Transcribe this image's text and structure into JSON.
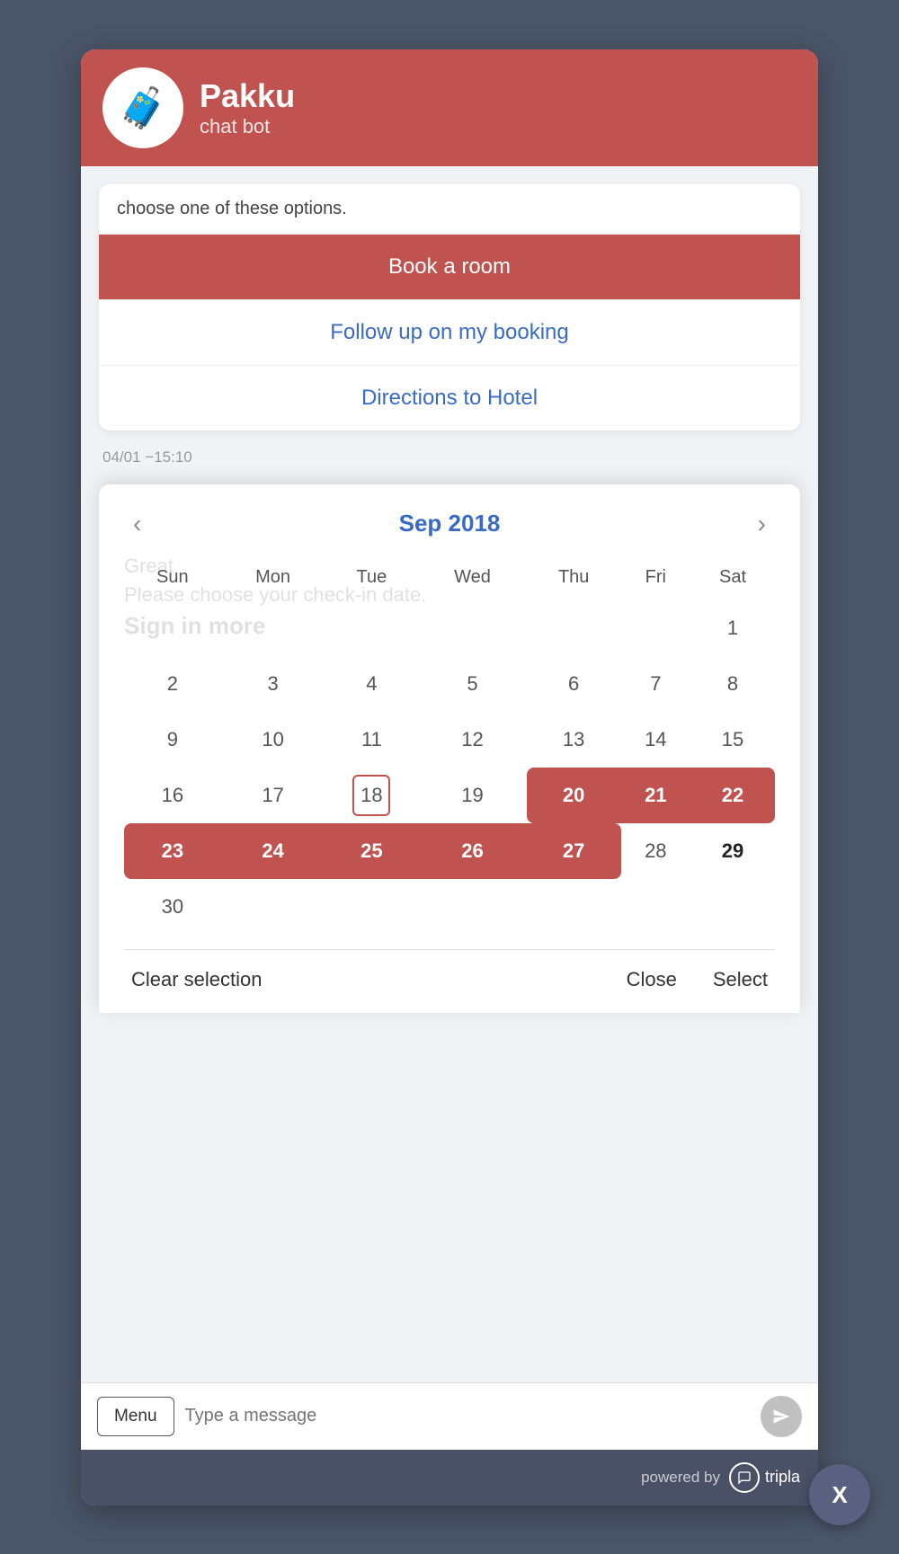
{
  "header": {
    "bot_name": "Pakku",
    "bot_subtitle": "chat bot"
  },
  "chat": {
    "intro_text": "choose one of these options.",
    "options": [
      {
        "label": "Book a room",
        "type": "primary"
      },
      {
        "label": "Follow up on my booking",
        "type": "secondary"
      },
      {
        "label": "Directions to Hotel",
        "type": "secondary"
      }
    ],
    "timestamp": "04/01 −15:10"
  },
  "calendar": {
    "month_title": "Sep 2018",
    "ghost_text1": "Great",
    "ghost_text2": "Please choose your check-in date.",
    "ghost_text3": "Sign in more",
    "days_of_week": [
      "Sun",
      "Mon",
      "Tue",
      "Wed",
      "Thu",
      "Fri",
      "Sat"
    ],
    "weeks": [
      [
        null,
        null,
        null,
        null,
        null,
        null,
        "1"
      ],
      [
        "2",
        "3",
        "4",
        "5",
        "6",
        "7",
        "8"
      ],
      [
        "9",
        "10",
        "11",
        "12",
        "13",
        "14",
        "15"
      ],
      [
        "16",
        "17",
        "18",
        "19",
        "20",
        "21",
        "22"
      ],
      [
        "23",
        "24",
        "25",
        "26",
        "27",
        "28",
        "29"
      ],
      [
        "30",
        null,
        null,
        null,
        null,
        null,
        null
      ]
    ],
    "today": "18",
    "highlighted_range": [
      20,
      21,
      22,
      23,
      24,
      25,
      26,
      27
    ],
    "bold_days": [
      "20",
      "27"
    ],
    "footer": {
      "clear_label": "Clear selection",
      "close_label": "Close",
      "select_label": "Select"
    }
  },
  "input_bar": {
    "menu_label": "Menu",
    "placeholder": "Type a message"
  },
  "powered": {
    "text": "powered by",
    "brand": "tripla"
  },
  "close_btn": "X"
}
